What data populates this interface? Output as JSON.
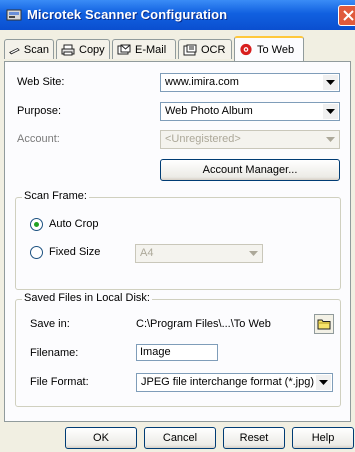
{
  "window": {
    "title": "Microtek Scanner Configuration",
    "app_icon": "scanner-app-icon",
    "close_icon": "close-icon"
  },
  "tabs": [
    {
      "label": "Scan",
      "icon": "scan-icon"
    },
    {
      "label": "Copy",
      "icon": "printer-icon"
    },
    {
      "label": "E-Mail",
      "icon": "email-icon"
    },
    {
      "label": "OCR",
      "icon": "ocr-icon"
    },
    {
      "label": "To Web",
      "icon": "web-icon",
      "active": true
    }
  ],
  "form": {
    "web_site_label": "Web Site:",
    "web_site_value": "www.imira.com",
    "purpose_label": "Purpose:",
    "purpose_value": "Web Photo Album",
    "account_label": "Account:",
    "account_value": "<Unregistered>",
    "account_manager_label": "Account Manager..."
  },
  "scan_frame": {
    "title": "Scan Frame:",
    "auto_crop_label": "Auto Crop",
    "fixed_size_label": "Fixed Size",
    "fixed_size_value": "A4",
    "selected": "Auto Crop"
  },
  "saved_files": {
    "title": "Saved Files in Local Disk:",
    "save_in_label": "Save in:",
    "save_in_value": "C:\\Program Files\\...\\To Web",
    "filename_label": "Filename:",
    "filename_value": "Image",
    "file_format_label": "File Format:",
    "file_format_value": "JPEG file interchange format (*.jpg)"
  },
  "footer": {
    "ok_label": "OK",
    "cancel_label": "Cancel",
    "reset_label": "Reset",
    "help_label": "Help"
  },
  "colors": {
    "titlebar": "#0a4fd0",
    "tab_highlight": "#ffc83c",
    "radio_dot": "#21a121"
  }
}
